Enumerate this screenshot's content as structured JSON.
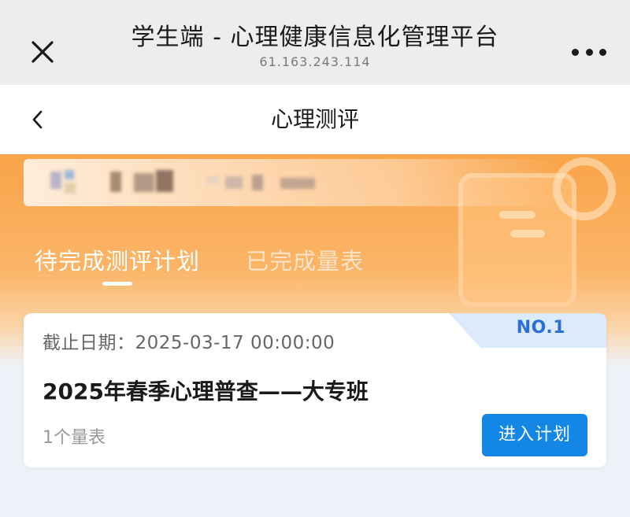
{
  "browser": {
    "title": "学生端 - 心理健康信息化管理平台",
    "url": "61.163.243.114",
    "close_icon": "close-icon",
    "more_icon": "more-dots-icon"
  },
  "nav": {
    "title": "心理测评",
    "back_icon": "chevron-left-icon"
  },
  "tabs": [
    {
      "label": "待完成测评计划",
      "active": true
    },
    {
      "label": "已完成量表",
      "active": false
    }
  ],
  "plan_card": {
    "badge": "NO.1",
    "deadline": "截止日期：2025-03-17 00:00:00",
    "title": "2025年春季心理普查——大专班",
    "scale_count": "1个量表",
    "enter_label": "进入计划"
  },
  "colors": {
    "accent_orange": "#f9a449",
    "button_blue": "#1486e6",
    "badge_text": "#2a6fd8"
  }
}
